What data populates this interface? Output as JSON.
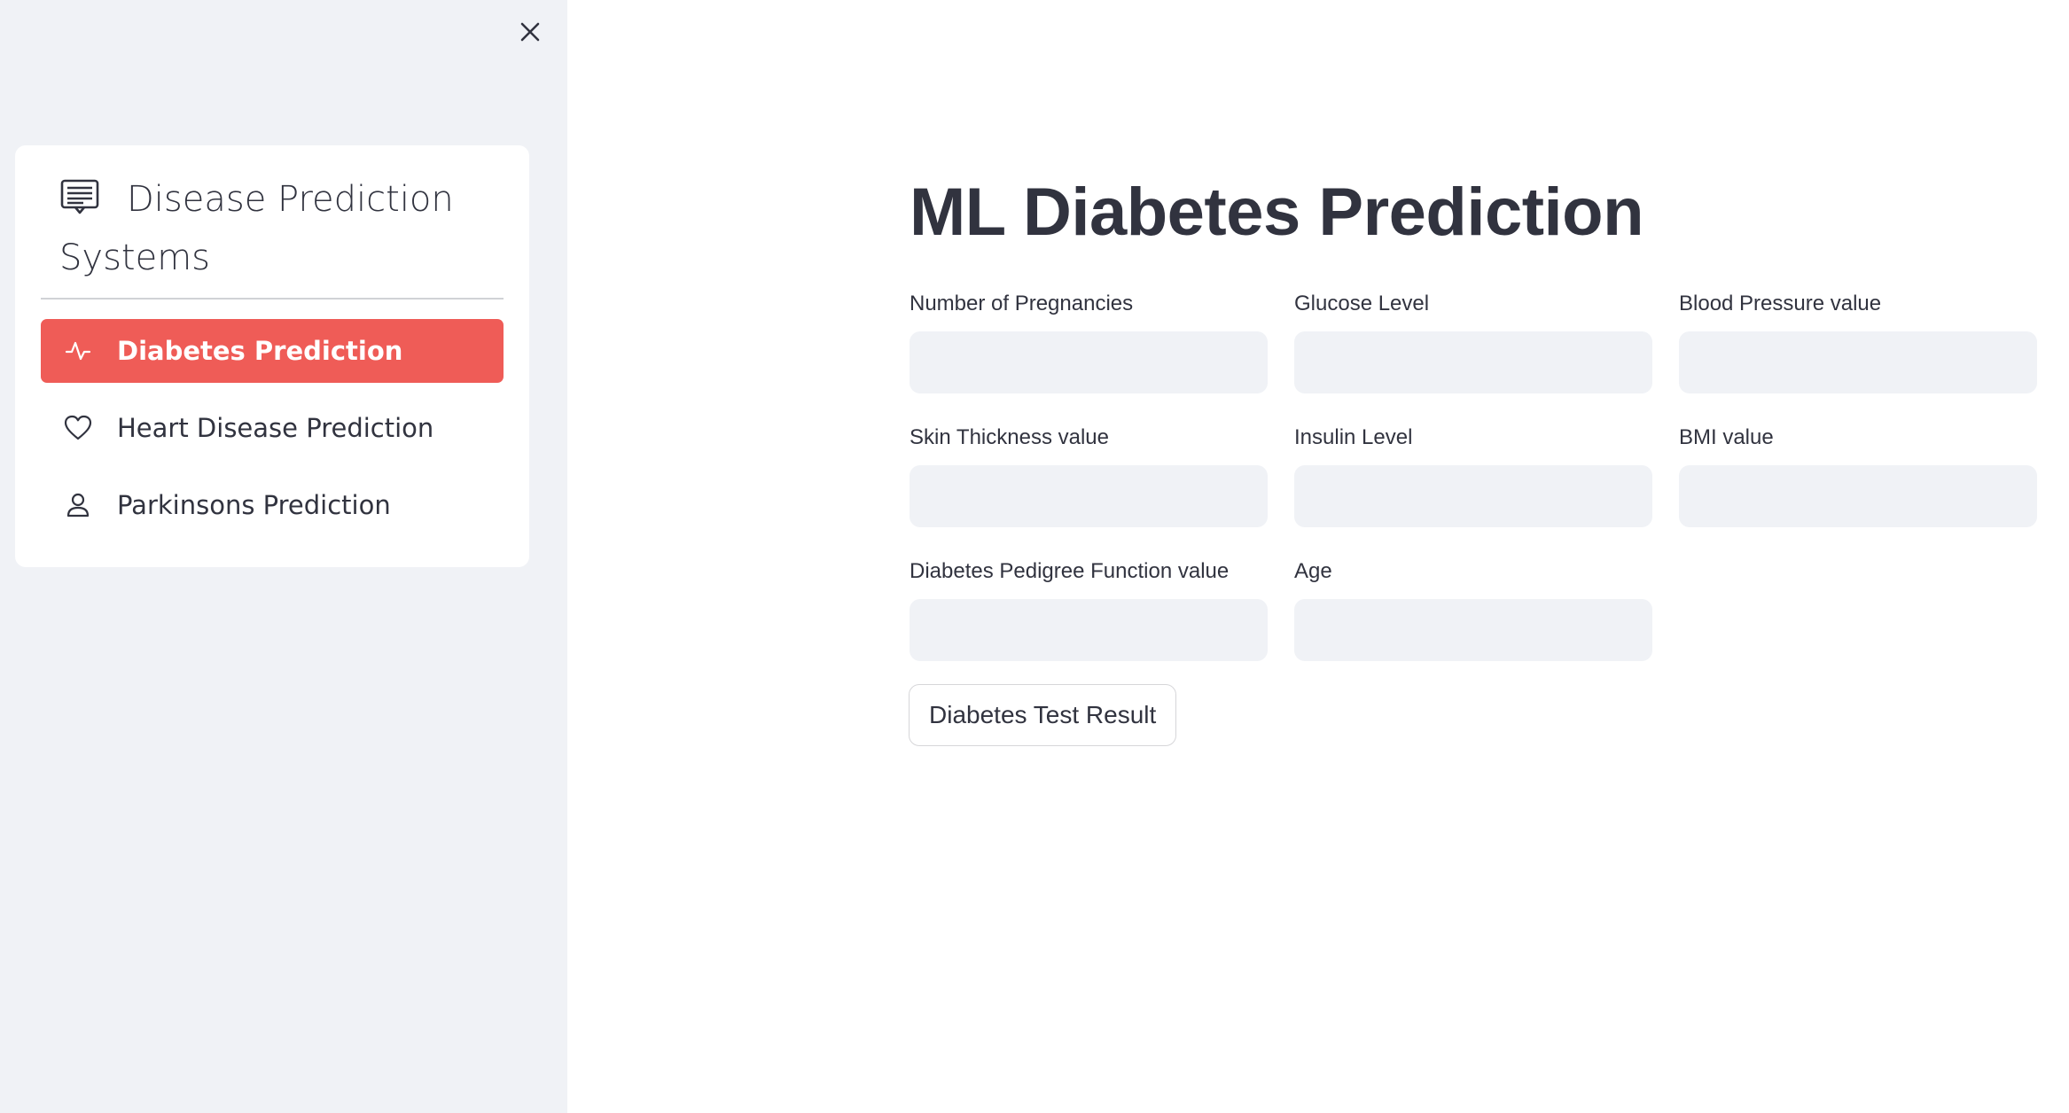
{
  "sidebar": {
    "close_icon": "close-icon",
    "menu": {
      "title": "Disease Prediction Systems",
      "title_icon": "menu-icon",
      "accent_color": "#ef5c57",
      "items": [
        {
          "label": "Diabetes Prediction",
          "icon": "activity-icon",
          "active": true
        },
        {
          "label": "Heart Disease Prediction",
          "icon": "heart-icon",
          "active": false
        },
        {
          "label": "Parkinsons Prediction",
          "icon": "person-icon",
          "active": false
        }
      ]
    }
  },
  "main": {
    "title": "ML Diabetes Prediction",
    "fields": [
      {
        "label": "Number of Pregnancies",
        "value": ""
      },
      {
        "label": "Glucose Level",
        "value": ""
      },
      {
        "label": "Blood Pressure value",
        "value": ""
      },
      {
        "label": "Skin Thickness value",
        "value": ""
      },
      {
        "label": "Insulin Level",
        "value": ""
      },
      {
        "label": "BMI value",
        "value": ""
      },
      {
        "label": "Diabetes Pedigree Function value",
        "value": ""
      },
      {
        "label": "Age",
        "value": ""
      }
    ],
    "submit_label": "Diabetes Test Result"
  }
}
